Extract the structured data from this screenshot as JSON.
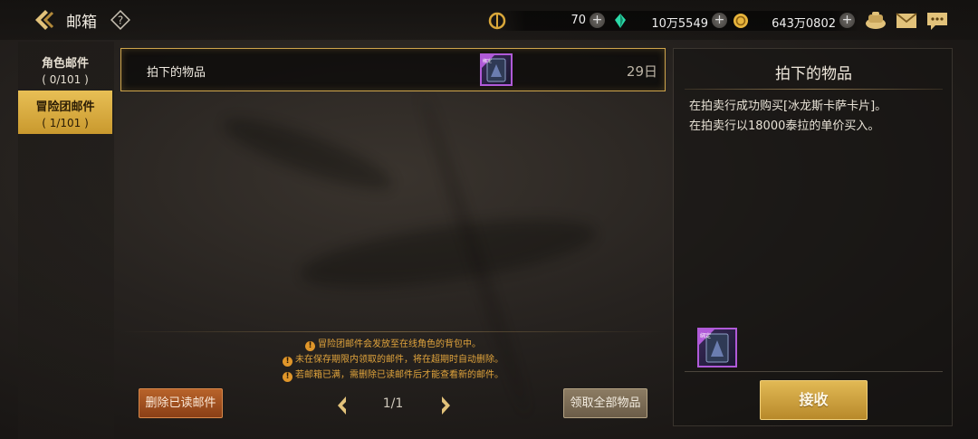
{
  "header": {
    "title": "邮箱",
    "help_label": "?"
  },
  "currencies": [
    {
      "icon": "c-coin-icon",
      "value": "70",
      "color": "#d9a73a"
    },
    {
      "icon": "gem-icon",
      "value": "10万5549",
      "color": "#2bd9a8"
    },
    {
      "icon": "gold-coin-icon",
      "value": "643万0802",
      "color": "#e7b43c"
    }
  ],
  "plus_label": "+",
  "tabs": [
    {
      "name": "角色邮件",
      "count": "( 0/101 )",
      "active": false
    },
    {
      "name": "冒险团邮件",
      "count": "( 1/101 )",
      "active": true
    }
  ],
  "mail_list": [
    {
      "subject": "拍下的物品",
      "days_left": "29日"
    }
  ],
  "notices": [
    "冒险团邮件会发放至在线角色的背包中。",
    "未在保存期限内领取的邮件，将在超期时自动删除。",
    "若邮箱已满，需删除已读邮件后才能查看新的邮件。"
  ],
  "notice_icon_glyph": "!",
  "item_badge": "绑定",
  "footer": {
    "delete_read_label": "删除已读邮件",
    "page_indicator": "1/1",
    "claim_all_label": "领取全部物品"
  },
  "detail": {
    "title": "拍下的物品",
    "lines": [
      "在拍卖行成功购买[冰龙斯卡萨卡片]。",
      "在拍卖行以18000泰拉的单价买入。"
    ],
    "receive_label": "接收"
  },
  "colors": {
    "accent_gold": "#d7ad4f",
    "item_rarity_purple": "#b05ad8",
    "notice_orange": "#e1a43c"
  }
}
